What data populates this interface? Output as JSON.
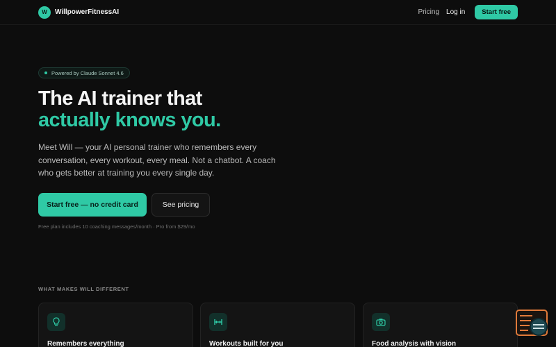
{
  "nav": {
    "logo_letter": "W",
    "brand": "WillpowerFitnessAI",
    "links": [
      "Pricing",
      "Log in"
    ],
    "cta": "Start free"
  },
  "hero": {
    "badge": "Powered by Claude Sonnet 4.6",
    "headline_line1": "The AI trainer that",
    "headline_line2": "actually knows you.",
    "subtext": "Meet Will — your AI personal trainer who remembers every conversation, every workout, every meal. Not a chatbot. A coach who gets better at training you every single day.",
    "primary_cta": "Start free — no credit card",
    "secondary_cta": "See pricing",
    "fine_print": "Free plan includes 10 coaching messages/month · Pro from $29/mo"
  },
  "features": {
    "label": "WHAT MAKES WILL DIFFERENT",
    "cards": [
      {
        "title": "Remembers everything",
        "icon": "lightbulb-icon"
      },
      {
        "title": "Workouts built for you",
        "icon": "dumbbell-icon"
      },
      {
        "title": "Food analysis with vision",
        "icon": "camera-icon"
      }
    ]
  },
  "colors": {
    "accent": "#2fc9a5",
    "background": "#0d0d0d",
    "card": "#141414",
    "widget_orange": "#e07a3a",
    "widget_teal": "#1f4a52"
  }
}
